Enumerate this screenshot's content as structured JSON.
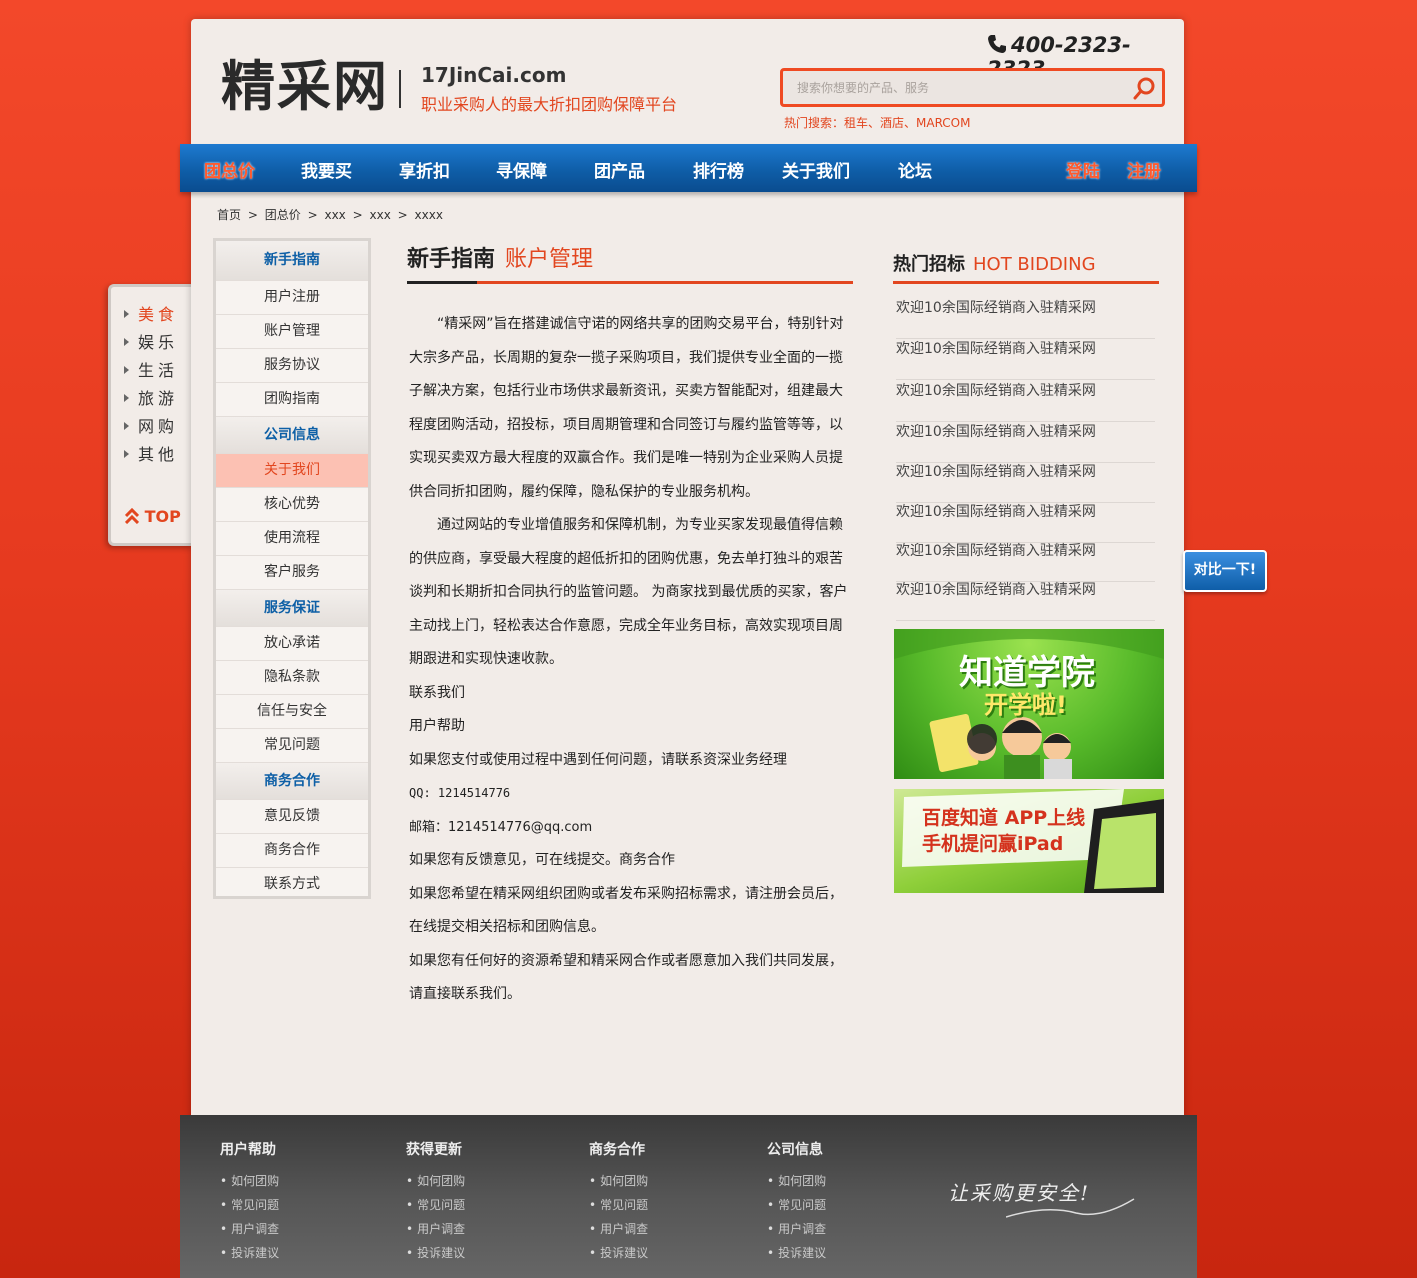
{
  "header": {
    "logo": "精采网",
    "domain": "17JinCai.com",
    "slogan": "职业采购人的最大折扣团购保障平台",
    "phone": "400-2323-2323",
    "search_placeholder": "搜索你想要的产品、服务",
    "hot_search": "热门搜索：租车、酒店、MARCOM"
  },
  "nav": {
    "items": [
      "团总价",
      "我要买",
      "享折扣",
      "寻保障",
      "团产品",
      "排行榜",
      "关于我们",
      "论坛"
    ],
    "login": "登陆",
    "register": "注册"
  },
  "breadcrumb": [
    "首页",
    ">",
    "团总价",
    ">",
    "xxx",
    ">",
    "xxx",
    ">",
    "xxxx"
  ],
  "float_menu": {
    "items": [
      "美食",
      "娱乐",
      "生活",
      "旅游",
      "网购",
      "其他"
    ],
    "top": "TOP"
  },
  "sidebar": {
    "sections": [
      {
        "title": "新手指南",
        "items": [
          "用户注册",
          "账户管理",
          "服务协议",
          "团购指南"
        ]
      },
      {
        "title": "公司信息",
        "items": [
          "关于我们",
          "核心优势",
          "使用流程",
          "客户服务"
        ]
      },
      {
        "title": "服务保证",
        "items": [
          "放心承诺",
          "隐私条款",
          "信任与安全",
          "常见问题"
        ]
      },
      {
        "title": "商务合作",
        "items": [
          "意见反馈",
          "商务合作",
          "联系方式"
        ]
      }
    ]
  },
  "content": {
    "title": "新手指南",
    "subtitle": "账户管理",
    "para1": "“精采网”旨在搭建诚信守诺的网络共享的团购交易平台，特别针对大宗多产品，长周期的复杂一揽子采购项目，我们提供专业全面的一揽子解决方案，包括行业市场供求最新资讯，买卖方智能配对，组建最大程度团购活动，招投标，项目周期管理和合同签订与履约监管等等，以实现买卖双方最大程度的双赢合作。我们是唯一特别为企业采购人员提供合同折扣团购，履约保障，隐私保护的专业服务机构。",
    "para2": "通过网站的专业增值服务和保障机制，为专业买家发现最值得信赖的供应商，享受最大程度的超低折扣的团购优惠，免去单打独斗的艰苦谈判和长期折扣合同执行的监管问题。 为商家找到最优质的买家，客户主动找上门，轻松表达合作意愿，完成全年业务目标，高效实现项目周期跟进和实现快速收款。",
    "line1": "联系我们",
    "line2": "用户帮助",
    "line3": "如果您支付或使用过程中遇到任何问题，请联系资深业务经理",
    "qq": "QQ: 1214514776",
    "email": "邮箱：1214514776@qq.com",
    "line4": "如果您有反馈意见，可在线提交。商务合作",
    "line5": "如果您希望在精采网组织团购或者发布采购招标需求，请注册会员后，在线提交相关招标和团购信息。",
    "line6": "如果您有任何好的资源希望和精采网合作或者愿意加入我们共同发展，请直接联系我们。"
  },
  "hot_bidding": {
    "title": "热门招标",
    "title_en": "HOT BIDDING",
    "items": [
      "欢迎10余国际经销商入驻精采网",
      "欢迎10余国际经销商入驻精采网",
      "欢迎10余国际经销商入驻精采网",
      "欢迎10余国际经销商入驻精采网",
      "欢迎10余国际经销商入驻精采网",
      "欢迎10余国际经销商入驻精采网",
      "欢迎10余国际经销商入驻精采网",
      "欢迎10余国际经销商入驻精采网"
    ]
  },
  "banners": {
    "b1_line1": "知道学院",
    "b1_line2": "开学啦!",
    "b2_line1": "百度知道 APP上线",
    "b2_line2": "手机提问赢iPad"
  },
  "compare_button": "对比一下!",
  "footer": {
    "columns": [
      {
        "title": "用户帮助",
        "links": [
          "如何团购",
          "常见问题",
          "用户调查",
          "投诉建议"
        ]
      },
      {
        "title": "获得更新",
        "links": [
          "如何团购",
          "常见问题",
          "用户调查",
          "投诉建议"
        ]
      },
      {
        "title": "商务合作",
        "links": [
          "如何团购",
          "常见问题",
          "用户调查",
          "投诉建议"
        ]
      },
      {
        "title": "公司信息",
        "links": [
          "如何团购",
          "常见问题",
          "用户调查",
          "投诉建议"
        ]
      }
    ],
    "slogan": "让采购更安全!"
  },
  "colors": {
    "accent_red": "#e2461f",
    "nav_blue": "#0f5ea8",
    "page_bg": "#f2ece8"
  }
}
